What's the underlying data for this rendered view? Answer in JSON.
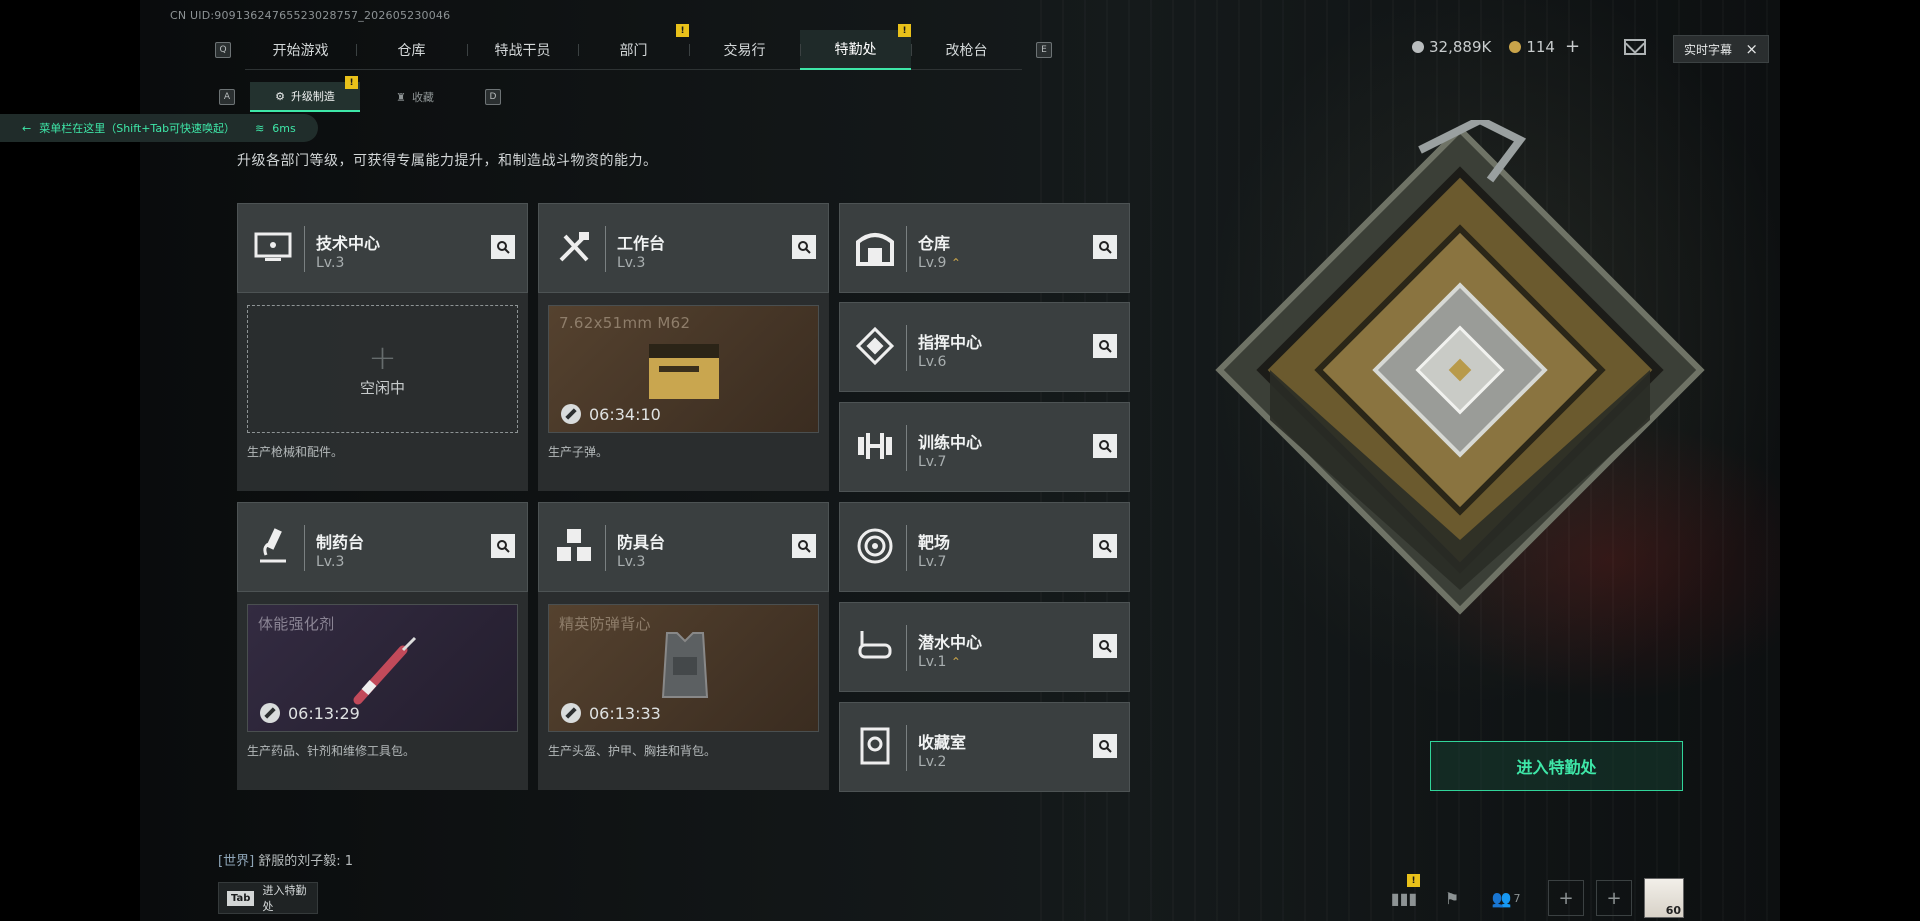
{
  "uid": "CN UID:909136247655230287​57_202605230046",
  "topnav": {
    "left_key": "Q",
    "right_key": "E",
    "tabs": [
      {
        "label": "开始游戏",
        "badge": ""
      },
      {
        "label": "仓库",
        "badge": ""
      },
      {
        "label": "特战干员",
        "badge": ""
      },
      {
        "label": "部门",
        "badge": "!"
      },
      {
        "label": "交易行",
        "badge": ""
      },
      {
        "label": "特勤处",
        "badge": "!",
        "active": true
      },
      {
        "label": "改枪台",
        "badge": ""
      }
    ]
  },
  "currency": {
    "silver": "32,889K",
    "gold": "114",
    "gold_add": "+",
    "silver_color": "#b9bdbe",
    "gold_color": "#c9a44a"
  },
  "subtitle_button": {
    "label": "实时字幕",
    "close": "×"
  },
  "subnav": {
    "left_key": "A",
    "right_key": "D",
    "tabs": [
      {
        "label": "升级制造",
        "icon": "upgrade-icon",
        "badge": "!",
        "active": true
      },
      {
        "label": "收藏",
        "icon": "trophy-icon",
        "badge": ""
      }
    ]
  },
  "hint": {
    "text": "菜单栏在这里（Shift+Tab可快速唤起）",
    "ping": "6ms",
    "arrow": "←"
  },
  "description": "升级各部门等级，可获得专属能力提升，和制造战斗物资的能力。",
  "production_cards": [
    {
      "name": "技术中心",
      "level": "Lv.3",
      "icon": "computer-icon",
      "slot": {
        "state": "idle",
        "plus": "+",
        "label": "空闲中"
      },
      "footer": "生产枪械和配件。"
    },
    {
      "name": "工作台",
      "level": "Lv.3",
      "icon": "tools-icon",
      "slot": {
        "state": "busy",
        "item": "7.62x51mm M62",
        "timer": "06:34:10",
        "tint": "#4a3a2c"
      },
      "footer": "生产子弹。"
    },
    {
      "name": "制药台",
      "level": "Lv.3",
      "icon": "microscope-icon",
      "slot": {
        "state": "busy",
        "item": "体能强化剂",
        "timer": "06:13:29",
        "tint": "#2d2638"
      },
      "footer": "生产药品、针剂和维修工具包。"
    },
    {
      "name": "防具台",
      "level": "Lv.3",
      "icon": "cubes-icon",
      "slot": {
        "state": "busy",
        "item": "精英防弹背心",
        "timer": "06:13:33",
        "tint": "#4a3a2c"
      },
      "footer": "生产头盔、护甲、胸挂和背包。"
    }
  ],
  "facility_cards": [
    {
      "name": "仓库",
      "level": "Lv.9",
      "icon": "warehouse-icon",
      "upgradable": true
    },
    {
      "name": "指挥中心",
      "level": "Lv.6",
      "icon": "command-icon",
      "upgradable": false
    },
    {
      "name": "训练中心",
      "level": "Lv.7",
      "icon": "dumbbell-icon",
      "upgradable": false
    },
    {
      "name": "靶场",
      "level": "Lv.7",
      "icon": "target-icon",
      "upgradable": false
    },
    {
      "name": "潜水中心",
      "level": "Lv.1",
      "icon": "goggles-icon",
      "upgradable": true
    },
    {
      "name": "收藏室",
      "level": "Lv.2",
      "icon": "vault-icon",
      "upgradable": false
    }
  ],
  "enter_button": "进入特勤处",
  "chat": {
    "channel": "[世界]",
    "text": "舒服的刘子毅: 1"
  },
  "tab_hint": {
    "key": "Tab",
    "label": "进入特勤处"
  },
  "bottombar": {
    "friends_count": "7",
    "level": "60",
    "plus": "+",
    "stats_badge": "!"
  },
  "accent_color": "#3ee7a8",
  "badge_color": "#e9c11a"
}
